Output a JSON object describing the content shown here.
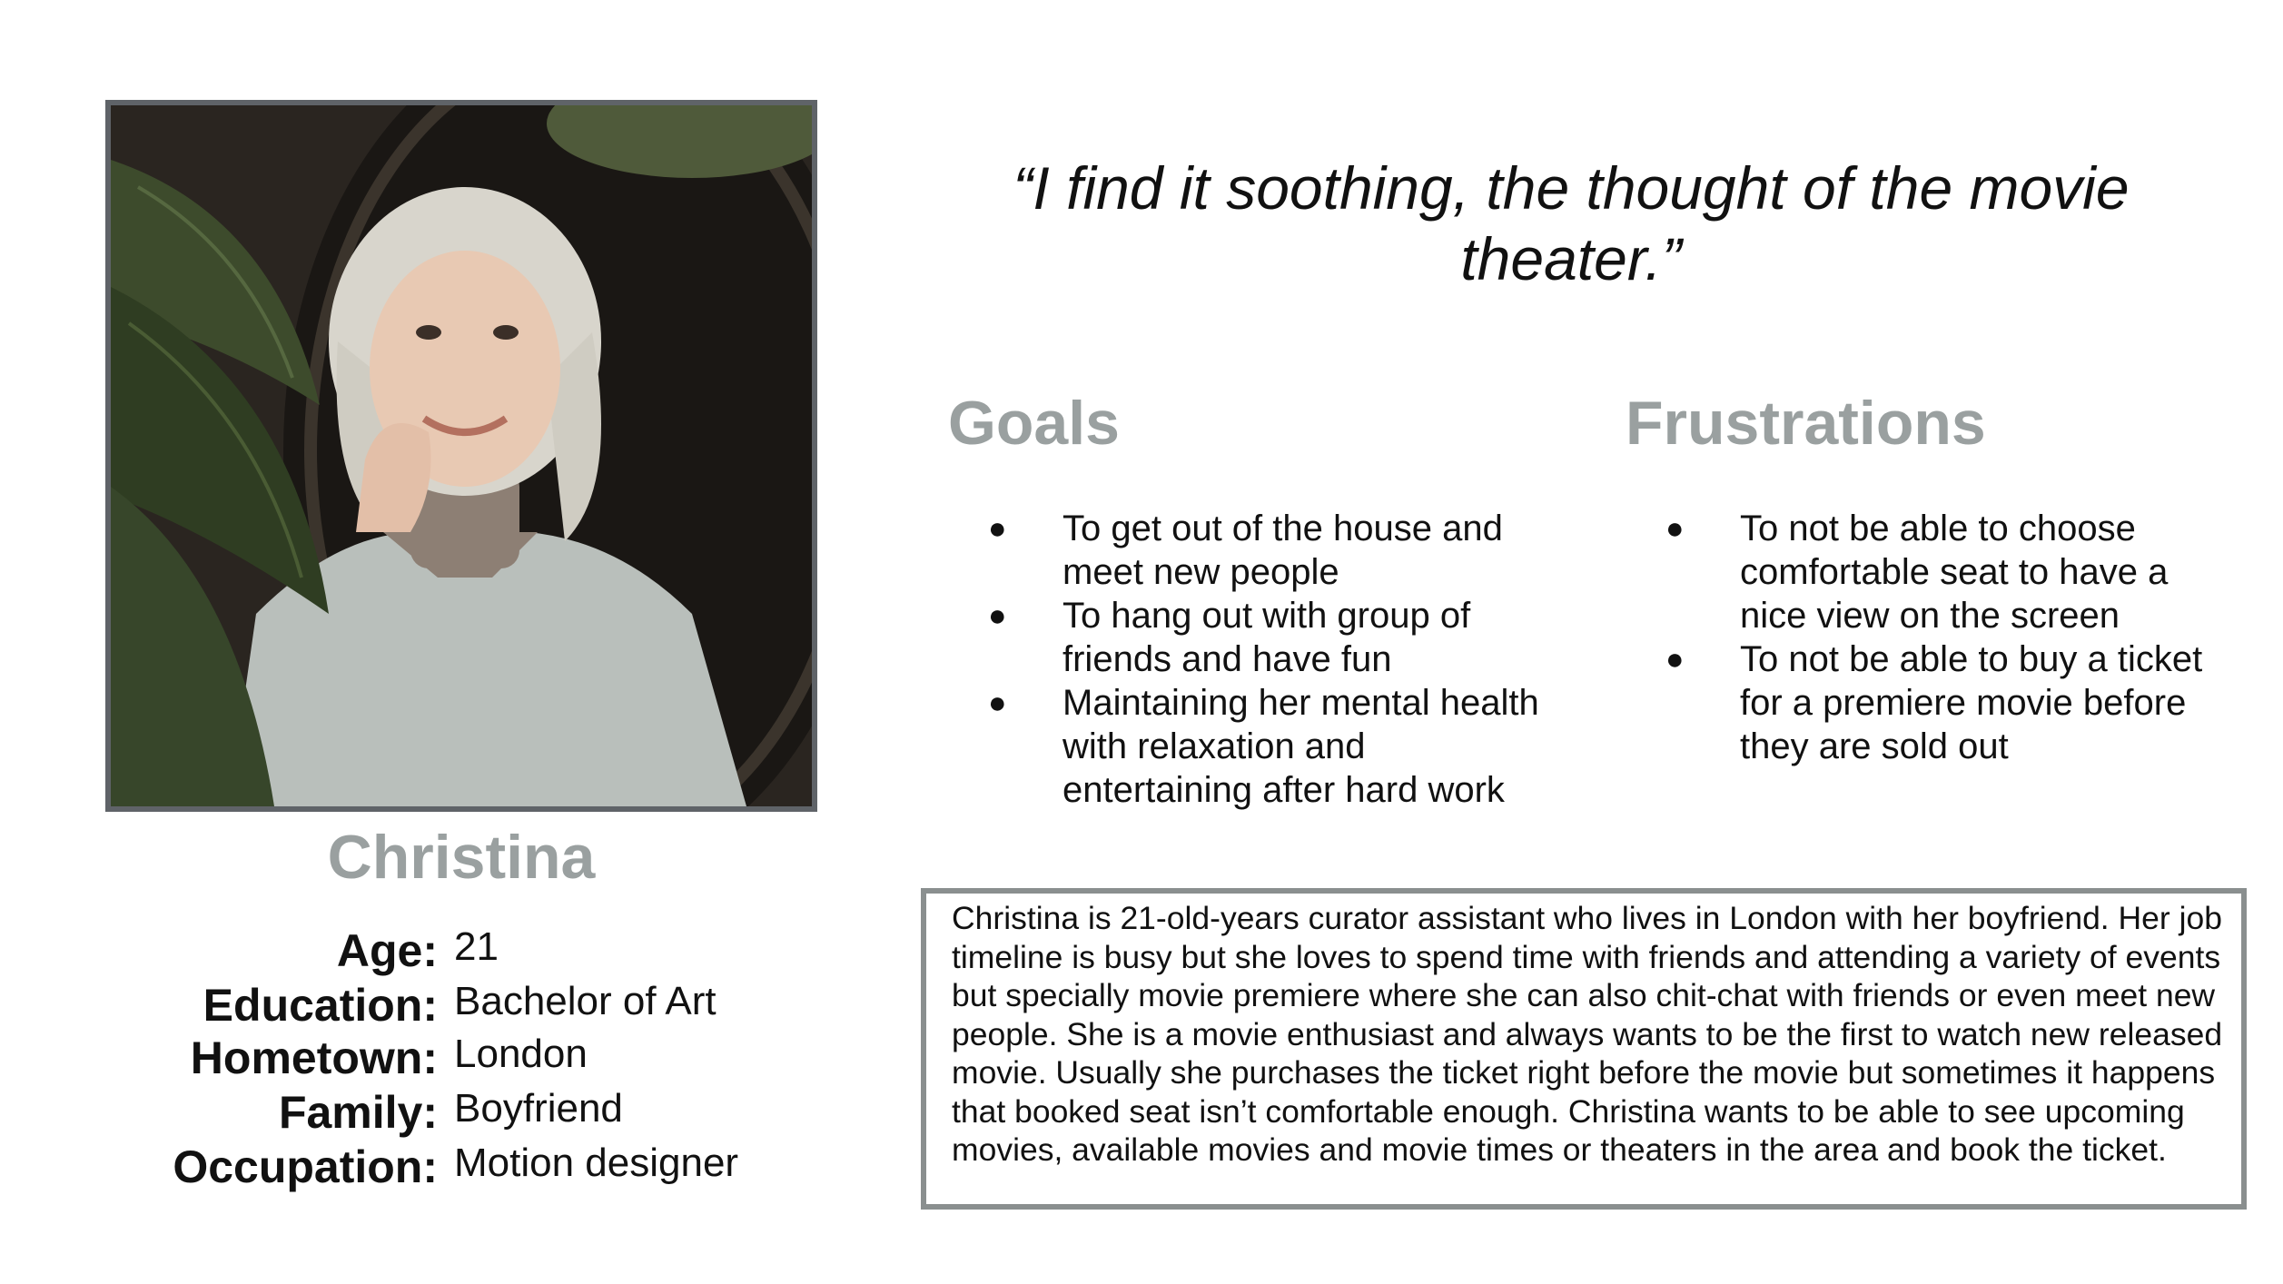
{
  "persona": {
    "photo_alt": "photo-of-christina",
    "name": "Christina",
    "details": [
      {
        "label": "Age:",
        "value": "21"
      },
      {
        "label": "Education:",
        "value": "Bachelor of Art"
      },
      {
        "label": "Hometown:",
        "value": "London"
      },
      {
        "label": "Family:",
        "value": "Boyfriend"
      },
      {
        "label": "Occupation:",
        "value": "Motion designer"
      }
    ]
  },
  "quote": "“I find it soothing, the thought of the movie theater.”",
  "goals": {
    "title": "Goals",
    "items": [
      "To get out of the house and meet new people",
      "To hang out with group of friends and have fun",
      "Maintaining her mental health with relaxation and entertaining after hard work"
    ]
  },
  "frustrations": {
    "title": "Frustrations",
    "items": [
      "To not be able to choose comfortable seat to have a nice view on the screen",
      "To not be able to buy a ticket for a premiere movie before they are sold out"
    ]
  },
  "bio": "Christina is 21-old-years curator assistant who lives in London with her boyfriend. Her job timeline is busy but she loves to spend time with friends and attending a variety of events but specially movie premiere where she can also chit-chat with friends or even meet new people. She is a movie enthusiast and always wants to be the first to watch new released movie. Usually she purchases the ticket right before the movie but sometimes it happens that  booked seat isn’t comfortable enough. Christina wants to be able to see upcoming movies, available movies and movie times or theaters in the area and  book the ticket.",
  "colors": {
    "heading_gray": "#9aa0a0",
    "photo_border": "#5f6368",
    "bio_border": "#8a8f8f"
  }
}
